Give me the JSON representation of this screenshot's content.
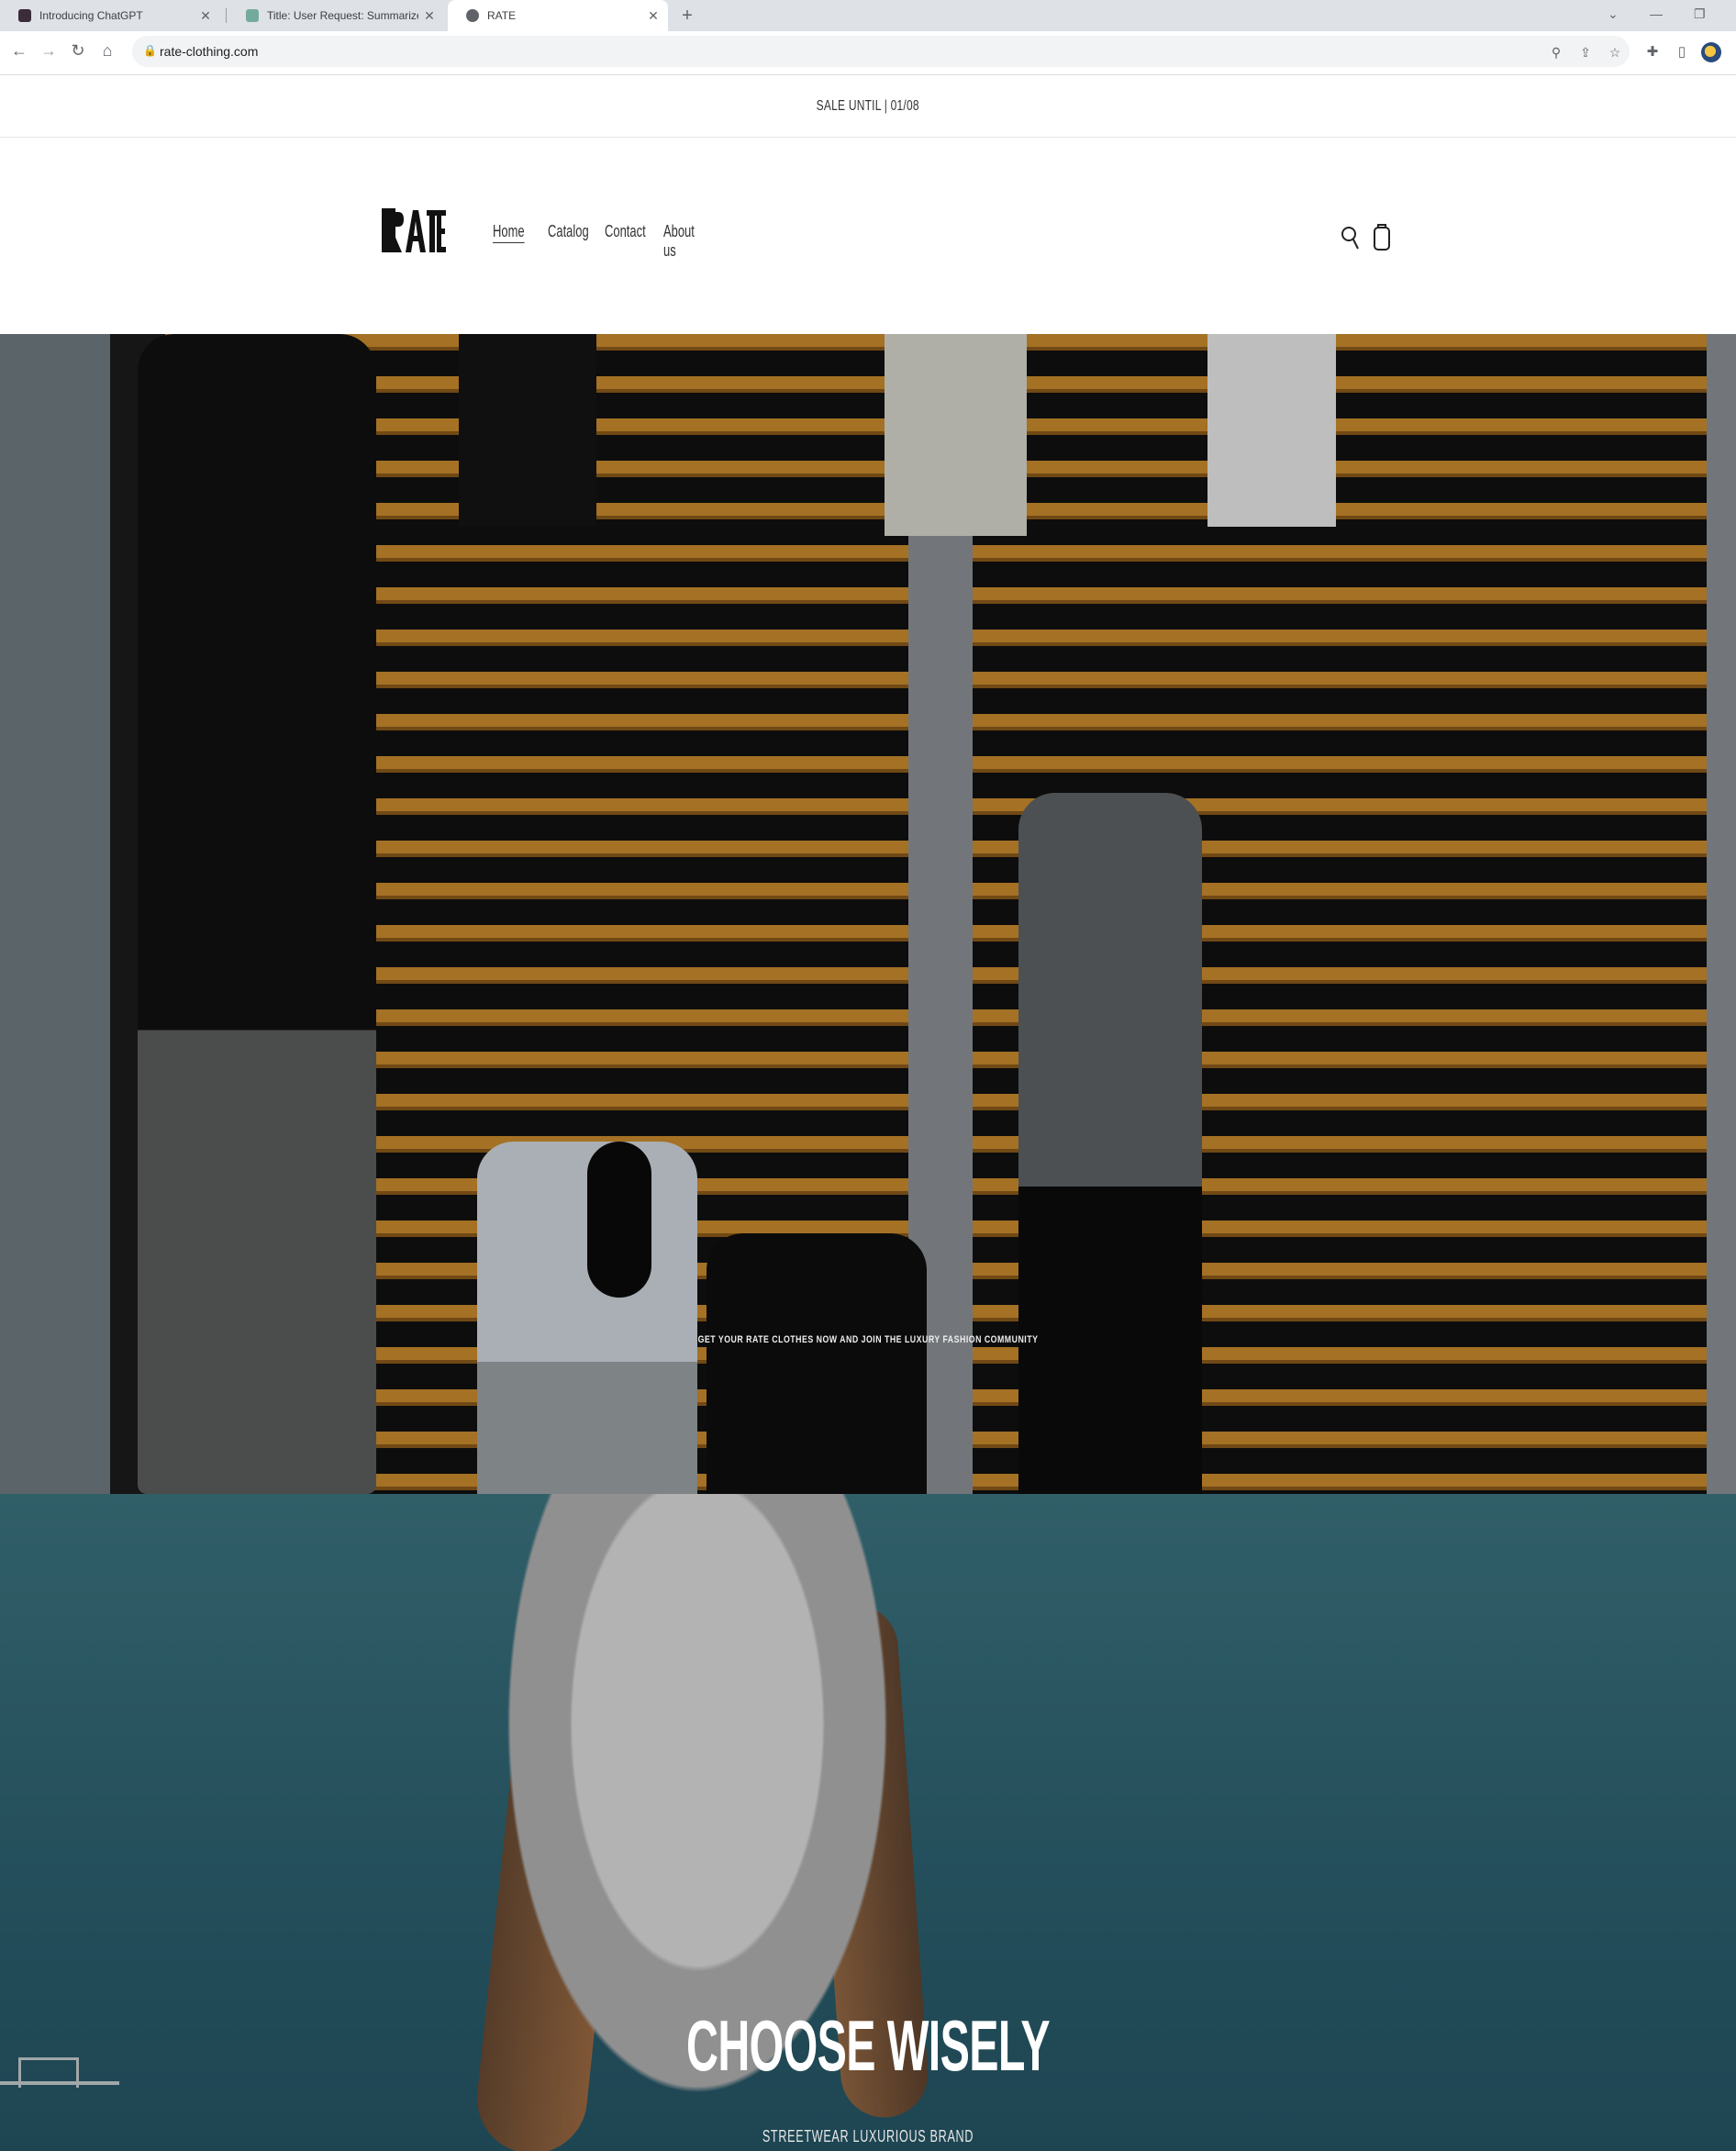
{
  "browser": {
    "tabs": [
      {
        "title": "Introducing ChatGPT",
        "active": false
      },
      {
        "title": "Title: User Request: Summarize C",
        "active": false
      },
      {
        "title": "RATE",
        "active": true
      }
    ],
    "new_tab_label": "+",
    "url": "rate-clothing.com",
    "icons": [
      "back-icon",
      "forward-icon",
      "reload-icon",
      "home-icon",
      "lock-icon",
      "zoom-icon",
      "share-icon",
      "star-icon",
      "extensions-icon",
      "sidebar-icon",
      "profile-icon"
    ]
  },
  "site": {
    "announcement": "SALE UNTIL | 01/08",
    "logo_text": "RATE",
    "nav": [
      {
        "label": "Home",
        "current": true
      },
      {
        "label": "Catalog",
        "current": false
      },
      {
        "label": "Contact",
        "current": false
      },
      {
        "label": "About us",
        "current": false
      }
    ],
    "header_icons": [
      "search-icon",
      "cart-icon"
    ],
    "hero1": {
      "caption": "GET YOUR RATE CLOTHES NOW AND JOIN THE LUXURY FASHION COMMUNITY"
    },
    "hero2": {
      "heading": "CHOOSE WISELY",
      "subheading": "STREETWEAR LUXURIOUS BRAND"
    }
  },
  "colors": {
    "accent_wood": "#c98a2e",
    "sky": "#2f6676"
  }
}
